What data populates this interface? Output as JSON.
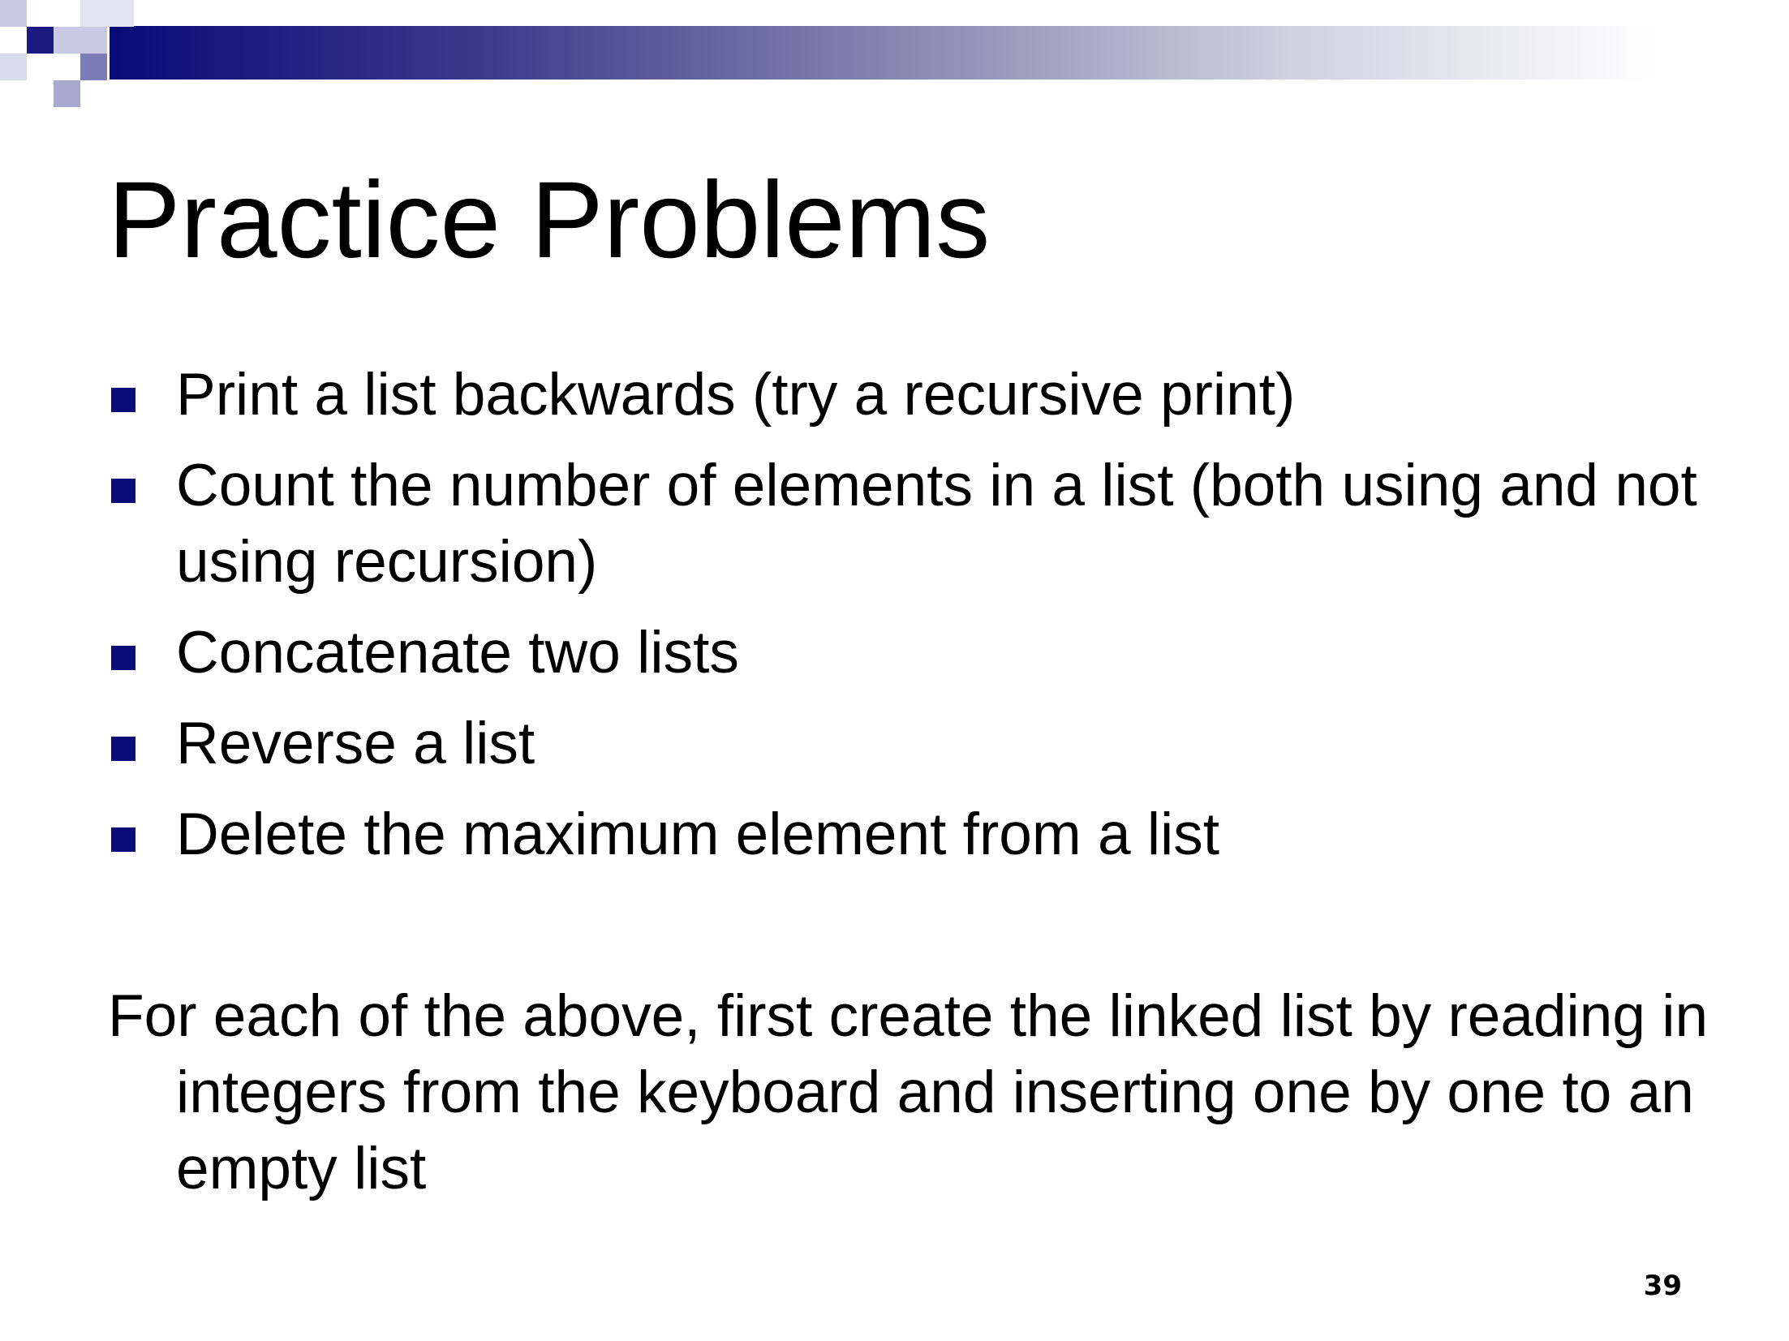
{
  "slide": {
    "title": "Practice Problems",
    "bullets": [
      "Print a list backwards (try a recursive print)",
      "Count the number of elements in a list (both using and not using recursion)",
      "Concatenate two lists",
      "Reverse a list",
      "Delete the maximum element from a list"
    ],
    "note": "For each of the above, first create the linked list by reading in integers from the keyboard and inserting one by one to an empty list",
    "page_number": "39"
  },
  "colors": {
    "accent": "#0a0a78",
    "text": "#000000",
    "background": "#ffffff"
  },
  "icons": {
    "bullet": "square-bullet-icon"
  }
}
